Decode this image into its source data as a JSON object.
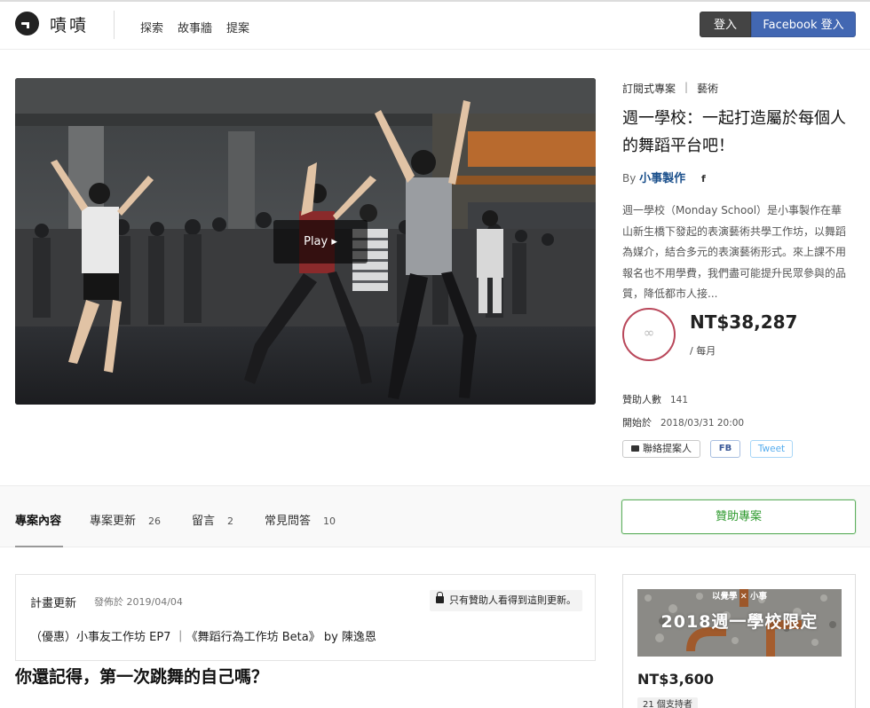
{
  "header": {
    "brand": "嘖嘖",
    "nav": [
      "探索",
      "故事牆",
      "提案"
    ],
    "login_label": "登入",
    "fb_login_label": "Facebook 登入"
  },
  "video": {
    "play_label": "Play ▸"
  },
  "project": {
    "category": "訂閱式專案",
    "subcategory": "藝術",
    "title": "週一學校：一起打造屬於每個人的舞蹈平台吧！",
    "by_label": "By",
    "author": "小事製作",
    "author_fb_icon": "f",
    "description": "週一學校（Monday School）是小事製作在華山新生橋下發起的表演藝術共學工作坊，以舞蹈為媒介，結合多元的表演藝術形式。來上課不用報名也不用學費，我們盡可能提升民眾參與的品質，降低都市人接...",
    "ring_label": "∞",
    "price": "NT$38,287",
    "period": "/ 每月",
    "backers_label": "贊助人數",
    "backers_count": "141",
    "start_label": "開始於",
    "start_date": "2018/03/31 20:00",
    "contact_label": "聯絡提案人",
    "fb_label": "FB",
    "tweet_label": "Tweet"
  },
  "tabs": [
    {
      "label": "專案內容",
      "count": ""
    },
    {
      "label": "專案更新",
      "count": "26"
    },
    {
      "label": "留言",
      "count": "2"
    },
    {
      "label": "常見問答",
      "count": "10"
    }
  ],
  "back_button_label": "贊助專案",
  "update": {
    "label": "計畫更新",
    "date": "發佈於 2019/04/04",
    "lock_text": "只有贊助人看得到這則更新。",
    "title": "（優惠）小事友工作坊 EP7 ｜《舞蹈行為工作坊 Beta》 by 陳逸恩"
  },
  "article_heading": "你還記得，第一次跳舞的自己嗎？",
  "reward": {
    "image_small_text": "以覺學 ✕ 小事",
    "image_big_text": "2018週一學校限定",
    "price": "NT$3,600",
    "backers": "21 個支持者"
  }
}
